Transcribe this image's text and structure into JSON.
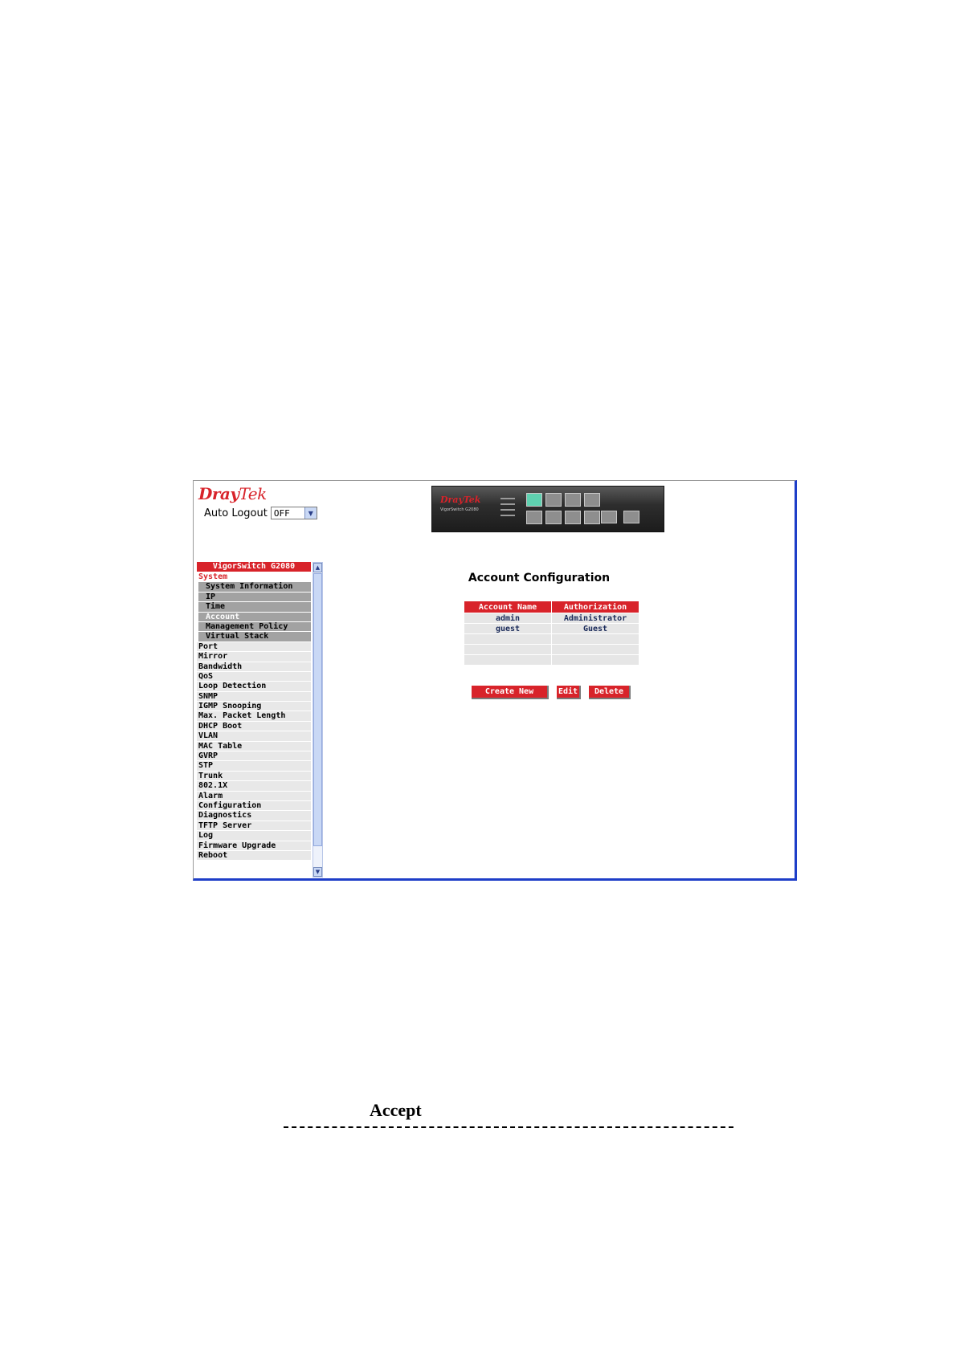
{
  "header": {
    "logo_part1": "Dray",
    "logo_part2": "Tek",
    "auto_logout_label": "Auto Logout",
    "auto_logout_value": "OFF"
  },
  "device": {
    "brand": "DrayTek",
    "model": "VigorSwitch G2080"
  },
  "sidebar": {
    "title": "VigorSwitch G2080",
    "items": [
      {
        "label": "System",
        "type": "cat",
        "active": true
      },
      {
        "label": "System Information",
        "type": "sub"
      },
      {
        "label": "IP",
        "type": "sub"
      },
      {
        "label": "Time",
        "type": "sub"
      },
      {
        "label": "Account",
        "type": "sub",
        "active": true
      },
      {
        "label": "Management Policy",
        "type": "sub"
      },
      {
        "label": "Virtual Stack",
        "type": "sub"
      },
      {
        "label": "Port",
        "type": "cat"
      },
      {
        "label": "Mirror",
        "type": "cat"
      },
      {
        "label": "Bandwidth",
        "type": "cat"
      },
      {
        "label": "QoS",
        "type": "cat"
      },
      {
        "label": "Loop Detection",
        "type": "cat"
      },
      {
        "label": "SNMP",
        "type": "cat"
      },
      {
        "label": "IGMP Snooping",
        "type": "cat"
      },
      {
        "label": "Max. Packet Length",
        "type": "cat"
      },
      {
        "label": "DHCP Boot",
        "type": "cat"
      },
      {
        "label": "VLAN",
        "type": "cat"
      },
      {
        "label": "MAC Table",
        "type": "cat"
      },
      {
        "label": "GVRP",
        "type": "cat"
      },
      {
        "label": "STP",
        "type": "cat"
      },
      {
        "label": "Trunk",
        "type": "cat"
      },
      {
        "label": "802.1X",
        "type": "cat"
      },
      {
        "label": "Alarm",
        "type": "cat"
      },
      {
        "label": "Configuration",
        "type": "cat"
      },
      {
        "label": "Diagnostics",
        "type": "cat"
      },
      {
        "label": "TFTP Server",
        "type": "cat"
      },
      {
        "label": "Log",
        "type": "cat"
      },
      {
        "label": "Firmware Upgrade",
        "type": "cat"
      },
      {
        "label": "Reboot",
        "type": "cat"
      }
    ]
  },
  "main": {
    "title": "Account Configuration",
    "table": {
      "headers": [
        "Account Name",
        "Authorization"
      ],
      "rows": [
        [
          "admin",
          "Administrator"
        ],
        [
          "guest",
          "Guest"
        ],
        [
          "",
          ""
        ],
        [
          "",
          ""
        ],
        [
          "",
          ""
        ]
      ]
    },
    "buttons": {
      "create": "Create New",
      "edit": "Edit",
      "delete": "Delete"
    }
  },
  "document": {
    "accept": "Accept"
  },
  "colors": {
    "brand_red": "#d8232a",
    "frame_blue": "#1e3ec8"
  }
}
